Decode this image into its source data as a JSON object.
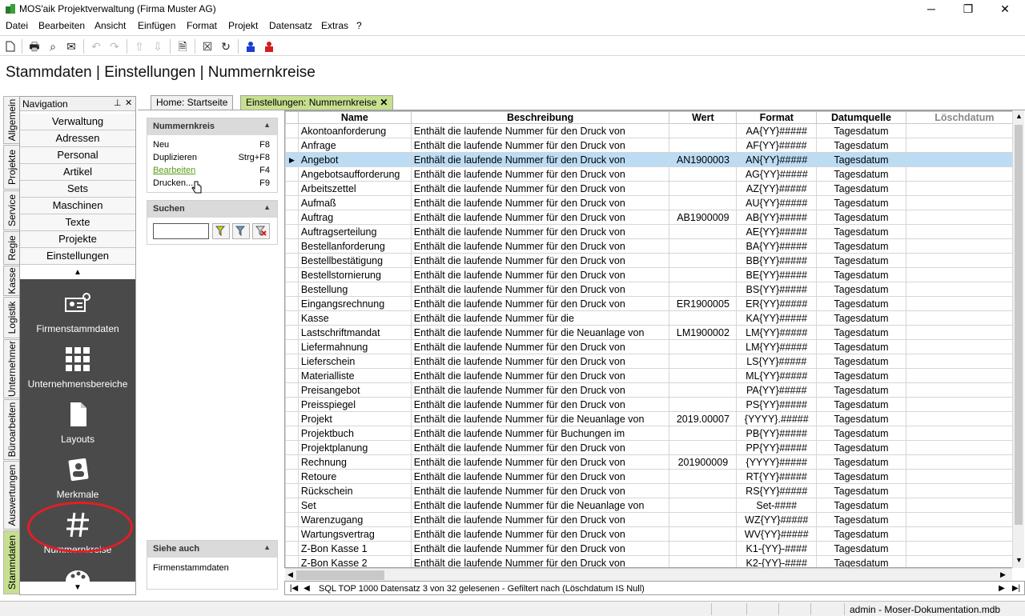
{
  "window": {
    "title": "MOS'aik Projektverwaltung (Firma Muster AG)",
    "minimize": "─",
    "restore": "❐",
    "close": "✕"
  },
  "menu": [
    "Datei",
    "Bearbeiten",
    "Ansicht",
    "Einfügen",
    "Format",
    "Projekt",
    "Datensatz",
    "Extras",
    "?"
  ],
  "page_title": "Stammdaten | Einstellungen | Nummernkreise",
  "vertical_tabs": [
    "Allgemein",
    "Projekte",
    "Service",
    "Regie",
    "Kasse",
    "Logistik",
    "Unternehmer",
    "Büroarbeiten",
    "Auswertungen",
    "Stammdaten"
  ],
  "navigation": {
    "title": "Navigation",
    "pin": "📌",
    "close": "✕",
    "buttons": [
      "Verwaltung",
      "Adressen",
      "Personal",
      "Artikel",
      "Sets",
      "Maschinen",
      "Texte",
      "Projekte",
      "Einstellungen"
    ],
    "big_items": [
      "Firmenstammdaten",
      "Unternehmensbereiche",
      "Layouts",
      "Merkmale",
      "Nummernkreise"
    ]
  },
  "doc_tabs": {
    "home": "Home: Startseite",
    "active": "Einstellungen: Nummernkreise",
    "close": "✕"
  },
  "actions_panel": {
    "title": "Nummernkreis",
    "items": [
      {
        "label": "Neu",
        "key": "F8"
      },
      {
        "label": "Duplizieren",
        "key": "Strg+F8"
      },
      {
        "label": "Bearbeiten",
        "key": "F4"
      },
      {
        "label": "Drucken...",
        "key": "F9"
      }
    ]
  },
  "search_panel": {
    "title": "Suchen",
    "value": ""
  },
  "see_also_panel": {
    "title": "Siehe auch",
    "items": [
      "Firmenstammdaten"
    ]
  },
  "grid": {
    "columns": [
      "Name",
      "Beschreibung",
      "Wert",
      "Format",
      "Datumquelle",
      "Löschdatum"
    ],
    "rows": [
      [
        "Akontoanforderung",
        "Enthält die laufende Nummer für den Druck von",
        "",
        "AA{YY}#####",
        "Tagesdatum",
        ""
      ],
      [
        "Anfrage",
        "Enthält die laufende Nummer für den Druck von",
        "",
        "AF{YY}#####",
        "Tagesdatum",
        ""
      ],
      [
        "Angebot",
        "Enthält die laufende Nummer für den Druck von",
        "AN1900003",
        "AN{YY}#####",
        "Tagesdatum",
        ""
      ],
      [
        "Angebotsaufforderung",
        "Enthält die laufende Nummer für den Druck von",
        "",
        "AG{YY}#####",
        "Tagesdatum",
        ""
      ],
      [
        "Arbeitszettel",
        "Enthält die laufende Nummer für den Druck von",
        "",
        "AZ{YY}#####",
        "Tagesdatum",
        ""
      ],
      [
        "Aufmaß",
        "Enthält die laufende Nummer für den Druck von",
        "",
        "AU{YY}#####",
        "Tagesdatum",
        ""
      ],
      [
        "Auftrag",
        "Enthält die laufende Nummer für den Druck von",
        "AB1900009",
        "AB{YY}#####",
        "Tagesdatum",
        ""
      ],
      [
        "Auftragserteilung",
        "Enthält die laufende Nummer für den Druck von",
        "",
        "AE{YY}#####",
        "Tagesdatum",
        ""
      ],
      [
        "Bestellanforderung",
        "Enthält die laufende Nummer für den Druck von",
        "",
        "BA{YY}#####",
        "Tagesdatum",
        ""
      ],
      [
        "Bestellbestätigung",
        "Enthält die laufende Nummer für den Druck von",
        "",
        "BB{YY}#####",
        "Tagesdatum",
        ""
      ],
      [
        "Bestellstornierung",
        "Enthält die laufende Nummer für den Druck von",
        "",
        "BE{YY}#####",
        "Tagesdatum",
        ""
      ],
      [
        "Bestellung",
        "Enthält die laufende Nummer für den Druck von",
        "",
        "BS{YY}#####",
        "Tagesdatum",
        ""
      ],
      [
        "Eingangsrechnung",
        "Enthält die laufende Nummer für den Druck von",
        "ER1900005",
        "ER{YY}#####",
        "Tagesdatum",
        ""
      ],
      [
        "Kasse",
        "Enthält die laufende Nummer für die",
        "",
        "KA{YY}#####",
        "Tagesdatum",
        ""
      ],
      [
        "Lastschriftmandat",
        "Enthält die laufende Nummer für die Neuanlage von",
        "LM1900002",
        "LM{YY}#####",
        "Tagesdatum",
        ""
      ],
      [
        "Liefermahnung",
        "Enthält die laufende Nummer für den Druck von",
        "",
        "LM{YY}#####",
        "Tagesdatum",
        ""
      ],
      [
        "Lieferschein",
        "Enthält die laufende Nummer für den Druck von",
        "",
        "LS{YY}#####",
        "Tagesdatum",
        ""
      ],
      [
        "Materialliste",
        "Enthält die laufende Nummer für den Druck von",
        "",
        "ML{YY}#####",
        "Tagesdatum",
        ""
      ],
      [
        "Preisangebot",
        "Enthält die laufende Nummer für den Druck von",
        "",
        "PA{YY}#####",
        "Tagesdatum",
        ""
      ],
      [
        "Preisspiegel",
        "Enthält die laufende Nummer für den Druck von",
        "",
        "PS{YY}#####",
        "Tagesdatum",
        ""
      ],
      [
        "Projekt",
        "Enthält die laufende Nummer für die Neuanlage von",
        "2019.00007",
        "{YYYY}.#####",
        "Tagesdatum",
        ""
      ],
      [
        "Projektbuch",
        "Enthält die laufende Nummer für Buchungen im",
        "",
        "PB{YY}#####",
        "Tagesdatum",
        ""
      ],
      [
        "Projektplanung",
        "Enthält die laufende Nummer für den Druck von",
        "",
        "PP{YY}#####",
        "Tagesdatum",
        ""
      ],
      [
        "Rechnung",
        "Enthält die laufende Nummer für den Druck von",
        "201900009",
        "{YYYY}#####",
        "Tagesdatum",
        ""
      ],
      [
        "Retoure",
        "Enthält die laufende Nummer für den Druck von",
        "",
        "RT{YY}#####",
        "Tagesdatum",
        ""
      ],
      [
        "Rückschein",
        "Enthält die laufende Nummer für den Druck von",
        "",
        "RS{YY}#####",
        "Tagesdatum",
        ""
      ],
      [
        "Set",
        "Enthält die laufende Nummer für die Neuanlage von",
        "",
        "Set-####",
        "Tagesdatum",
        ""
      ],
      [
        "Warenzugang",
        "Enthält die laufende Nummer für den Druck von",
        "",
        "WZ{YY}#####",
        "Tagesdatum",
        ""
      ],
      [
        "Wartungsvertrag",
        "Enthält die laufende Nummer für den Druck von",
        "",
        "WV{YY}#####",
        "Tagesdatum",
        ""
      ],
      [
        "Z-Bon Kasse 1",
        "Enthält die laufende Nummer für den Druck von",
        "",
        "K1-{YY}-####",
        "Tagesdatum",
        ""
      ],
      [
        "Z-Bon Kasse 2",
        "Enthält die laufende Nummer für den Druck von",
        "",
        "K2-{YY}-####",
        "Tagesdatum",
        ""
      ]
    ],
    "selected_row": 2
  },
  "record_nav": "SQL TOP 1000 Datensatz 3 von 32 gelesenen - Gefiltert nach (Löschdatum IS Null)",
  "status": {
    "user": "admin - Moser-Dokumentation.mdb"
  },
  "colors": {
    "accent_green": "#c7e08f",
    "selection": "#bcdcf4",
    "ring": "#e41e26"
  }
}
